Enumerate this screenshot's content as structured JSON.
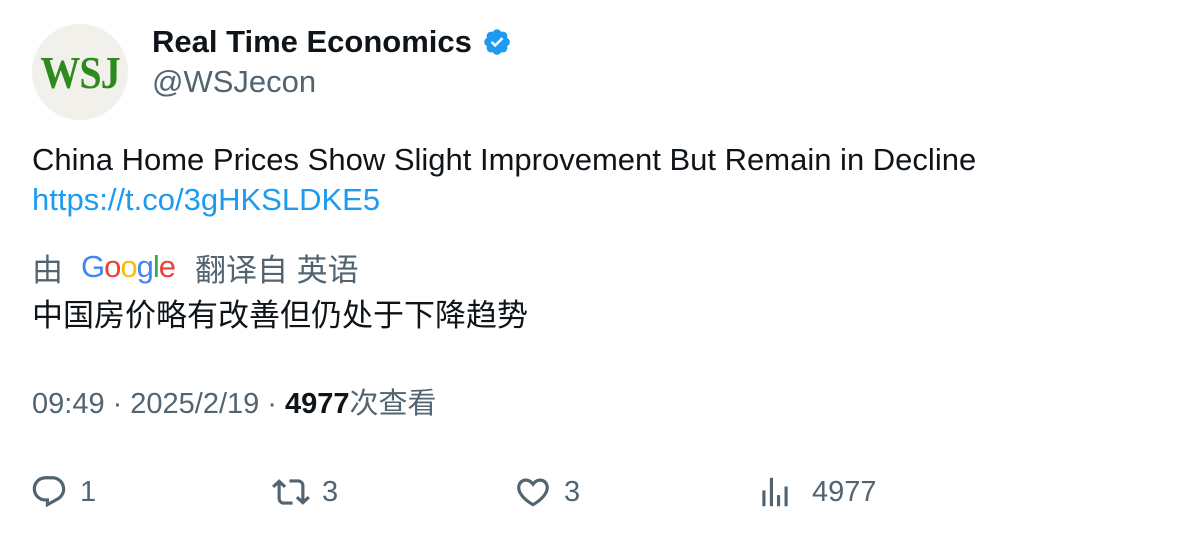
{
  "author": {
    "display_name": "Real Time Economics",
    "handle": "@WSJecon",
    "avatar_text": "WSJ",
    "verified": true
  },
  "tweet": {
    "text": "China Home Prices Show Slight Improvement But Remain in Decline",
    "link": "https://t.co/3gHKSLDKE5"
  },
  "translation": {
    "prefix": "由",
    "provider_letters": [
      "G",
      "o",
      "o",
      "g",
      "l",
      "e"
    ],
    "provider_colors": [
      "#4285f4",
      "#ea4335",
      "#fbbc05",
      "#4285f4",
      "#34a853",
      "#ea4335"
    ],
    "suffix": "翻译自 英语",
    "text": "中国房价略有改善但仍处于下降趋势"
  },
  "meta": {
    "time": "09:49",
    "separator": "·",
    "date": "2025/2/19",
    "views_count": "4977",
    "views_label": "次查看"
  },
  "actions": {
    "replies": "1",
    "retweets": "3",
    "likes": "3",
    "views": "4977"
  },
  "colors": {
    "link": "#1d9bf0",
    "secondary_text": "#536471",
    "primary_text": "#0f1419",
    "verified": "#1d9bf0",
    "avatar_logo": "#2f8a1e"
  },
  "icons": {
    "verified": "verified-badge-icon",
    "reply": "reply-icon",
    "retweet": "retweet-icon",
    "like": "heart-icon",
    "views": "bar-chart-icon"
  }
}
